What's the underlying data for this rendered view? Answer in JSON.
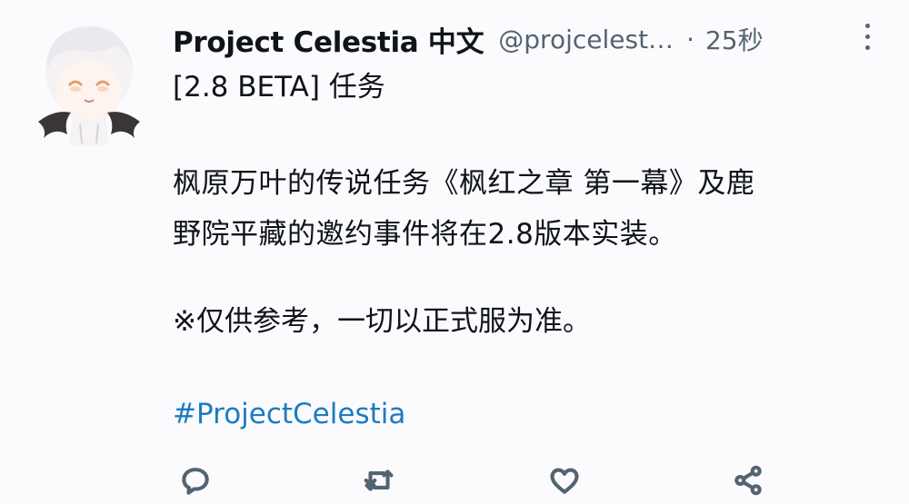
{
  "tweet": {
    "display_name": "Project Celestia 中文",
    "handle": "@projcelest…",
    "separator": "·",
    "time": "25秒",
    "tag_line": "[2.8 BETA] 任务",
    "body_lines": [
      "枫原万叶的传说任务《枫红之章 第一幕》及鹿",
      "野院平藏的邀约事件将在2.8版本实装。"
    ],
    "note": "※仅供参考，一切以正式服为准。",
    "hashtag": "#ProjectCelestia"
  },
  "icons": {
    "more": "more-vertical-icon",
    "reply": "reply-icon",
    "retweet": "retweet-icon",
    "like": "like-icon",
    "share": "share-icon"
  },
  "colors": {
    "text": "#0f1419",
    "secondary": "#536471",
    "link": "#1d7bc2",
    "background": "#fbfbfd"
  }
}
